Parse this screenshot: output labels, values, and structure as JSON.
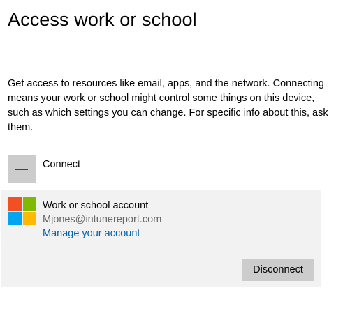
{
  "page": {
    "title": "Access work or school",
    "description": "Get access to resources like email, apps, and the network. Connecting means your work or school might control some things on this device, such as which settings you can change. For specific info about this, ask them."
  },
  "connect": {
    "icon": "plus-icon",
    "label": "Connect"
  },
  "account": {
    "icon": "microsoft-logo-icon",
    "name": "Work or school account",
    "email": "Mjones@intunereport.com",
    "manage_link": "Manage your account",
    "disconnect_label": "Disconnect"
  },
  "colors": {
    "link": "#0063b1",
    "logo_red": "#f25022",
    "logo_green": "#7fba00",
    "logo_blue": "#00a4ef",
    "logo_yellow": "#ffb900",
    "panel_background": "#f2f2f2",
    "button_background": "#cccccc"
  }
}
